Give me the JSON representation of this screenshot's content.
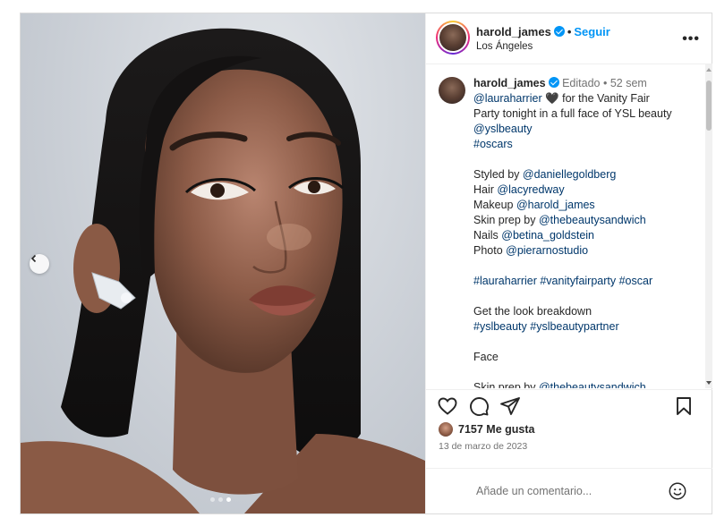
{
  "post": {
    "user": "harold_james",
    "follow_label": "Seguir",
    "separator": "•",
    "location": "Los Ángeles",
    "more_label": "•••"
  },
  "carousel": {
    "prev_icon": "chevron-left-icon",
    "dots_count": 3,
    "active_dot": 2
  },
  "caption": {
    "user": "harold_james",
    "edited": "Editado",
    "separator": "•",
    "age": "52 sem",
    "lines": [
      {
        "parts": [
          {
            "t": "@lauraharrier",
            "link": true
          },
          {
            "t": " 🖤  for the Vanity Fair"
          }
        ]
      },
      {
        "parts": [
          {
            "t": "Party tonight in a full face of YSL beauty"
          }
        ]
      },
      {
        "parts": [
          {
            "t": "@yslbeauty",
            "link": true
          }
        ]
      },
      {
        "parts": [
          {
            "t": "#oscars",
            "link": true
          }
        ]
      },
      {
        "gap": true
      },
      {
        "parts": [
          {
            "t": "Styled by "
          },
          {
            "t": "@daniellegoldberg",
            "link": true
          }
        ]
      },
      {
        "parts": [
          {
            "t": "Hair "
          },
          {
            "t": "@lacyredway",
            "link": true
          }
        ]
      },
      {
        "parts": [
          {
            "t": "Makeup "
          },
          {
            "t": "@harold_james",
            "link": true
          }
        ]
      },
      {
        "parts": [
          {
            "t": "Skin prep by "
          },
          {
            "t": "@thebeautysandwich",
            "link": true
          }
        ]
      },
      {
        "parts": [
          {
            "t": "Nails "
          },
          {
            "t": "@betina_goldstein",
            "link": true
          }
        ]
      },
      {
        "parts": [
          {
            "t": "Photo "
          },
          {
            "t": "@pierarnostudio",
            "link": true
          }
        ]
      },
      {
        "gap": true
      },
      {
        "parts": [
          {
            "t": "#lauraharrier",
            "link": true
          },
          {
            "t": " "
          },
          {
            "t": "#vanityfairparty",
            "link": true
          },
          {
            "t": " "
          },
          {
            "t": "#oscar",
            "link": true
          }
        ]
      },
      {
        "gap": true
      },
      {
        "parts": [
          {
            "t": "Get the look breakdown"
          }
        ]
      },
      {
        "parts": [
          {
            "t": "#yslbeauty",
            "link": true
          },
          {
            "t": " "
          },
          {
            "t": "#yslbeautypartner",
            "link": true
          }
        ]
      },
      {
        "gap": true
      },
      {
        "parts": [
          {
            "t": "Face"
          }
        ]
      },
      {
        "gap": true
      },
      {
        "parts": [
          {
            "t": "Skin prep by "
          },
          {
            "t": "@thebeautysandwich",
            "link": true
          }
        ]
      }
    ]
  },
  "actions": {
    "like_icon": "heart-icon",
    "comment_icon": "comment-icon",
    "share_icon": "share-icon",
    "save_icon": "bookmark-icon"
  },
  "likes": "7157 Me gusta",
  "date": "13 de marzo de 2023",
  "comment": {
    "placeholder": "Añade un comentario...",
    "emoji_icon": "emoji-icon"
  },
  "colors": {
    "link": "#00376b",
    "follow": "#0095f6",
    "muted": "#737373",
    "text": "#262626"
  }
}
